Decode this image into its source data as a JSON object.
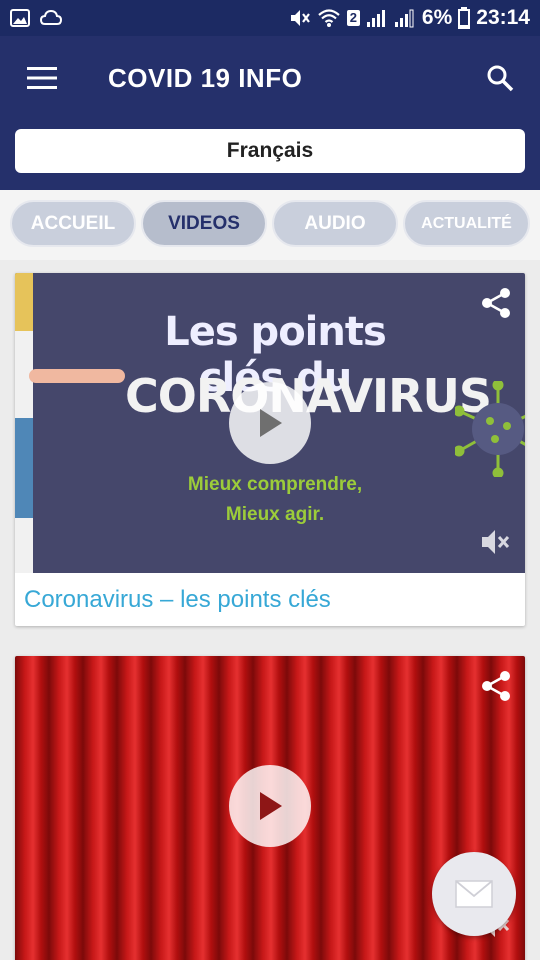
{
  "status_bar": {
    "signal_badge": "2",
    "battery": "6%",
    "time": "23:14"
  },
  "app_bar": {
    "title": "COVID 19 INFO",
    "menu_icon": "hamburger-menu-icon",
    "search_icon": "search-icon"
  },
  "language": {
    "selected": "Français"
  },
  "tabs": [
    {
      "label": "ACCUEIL",
      "active": false
    },
    {
      "label": "VIDEOS",
      "active": true
    },
    {
      "label": "AUDIO",
      "active": false
    },
    {
      "label": "ACTUALITÉ",
      "active": false
    }
  ],
  "videos": [
    {
      "title": "Coronavirus – les points clés",
      "thumbnail_line1": "Les points clés du",
      "thumbnail_line2": "CORONAVIRUS",
      "thumbnail_line3": "Mieux comprendre,",
      "thumbnail_line4": "Mieux agir."
    },
    {
      "title": "",
      "thumbnail": "red-curtain"
    }
  ],
  "fab": {
    "icon": "mail-icon"
  },
  "colors": {
    "app_bar": "#25306b",
    "status_bar": "#1c2a63",
    "title_link": "#37a8d6",
    "tab_bg": "#c9cfdc",
    "tab_active_text": "#25306b"
  }
}
